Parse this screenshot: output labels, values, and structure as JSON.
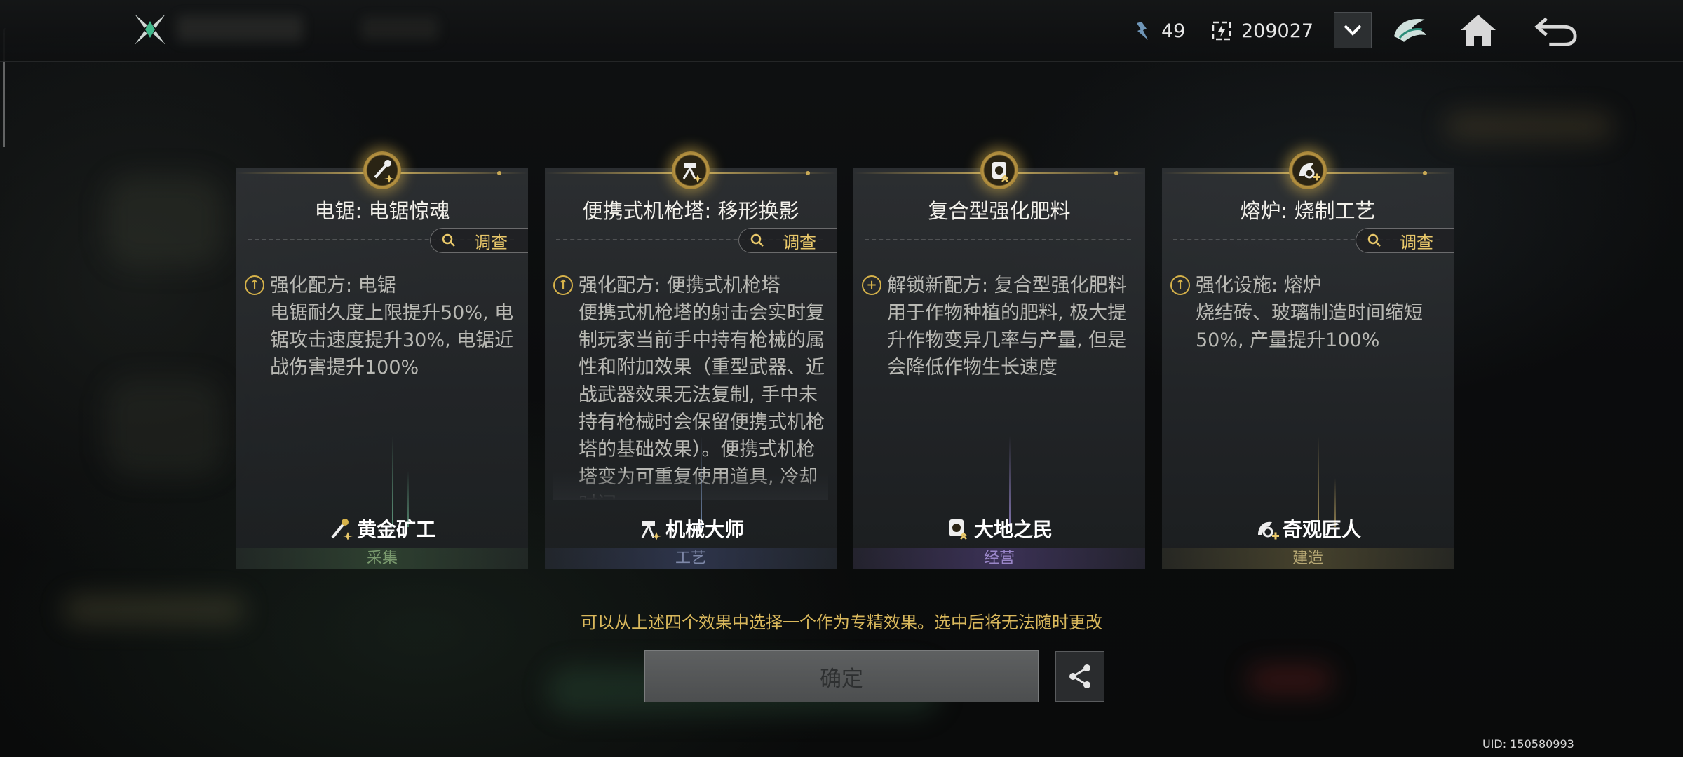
{
  "topbar": {
    "resource1_value": "49",
    "resource2_value": "209027"
  },
  "cards": [
    {
      "title": "电锯: 电锯惊魂",
      "investigate_label": "调查",
      "effect_head": "强化配方: 电锯",
      "effect_desc": "电锯耐久度上限提升50%, 电锯攻击速度提升30%, 电锯近战伤害提升100%",
      "role_name": "黄金矿工",
      "category": "采集",
      "category_color": "#7a9a6e"
    },
    {
      "title": "便携式机枪塔: 移形换影",
      "investigate_label": "调查",
      "effect_head": "强化配方: 便携式机枪塔",
      "effect_desc": "便携式机枪塔的射击会实时复制玩家当前手中持有枪械的属性和附加效果（重型武器、近战武器效果无法复制, 手中未持有枪械时会保留便携式机枪塔的基础效果）。便携式机枪塔变为可重复使用道具, 冷却时间",
      "role_name": "机械大师",
      "category": "工艺",
      "category_color": "#7e88a8"
    },
    {
      "title": "复合型强化肥料",
      "investigate_label": "",
      "effect_head": "解锁新配方: 复合型强化肥料",
      "effect_desc": "用于作物种植的肥料, 极大提升作物变异几率与产量, 但是会降低作物生长速度",
      "role_name": "大地之民",
      "category": "经营",
      "category_color": "#9a86c8"
    },
    {
      "title": "熔炉: 烧制工艺",
      "investigate_label": "调查",
      "effect_head": "强化设施: 熔炉",
      "effect_desc": "烧结砖、玻璃制造时间缩短50%, 产量提升100%",
      "role_name": "奇观匠人",
      "category": "建造",
      "category_color": "#b7a874"
    }
  ],
  "hint_text": "可以从上述四个效果中选择一个作为专精效果。选中后将无法随时更改",
  "confirm_label": "确定",
  "uid_text": "UID: 150580993",
  "icons": {
    "logo": "crossed-blades-logo-icon",
    "resource1": "energy-shard-icon",
    "resource2": "lightning-box-icon",
    "dropdown": "chevron-down-icon",
    "emblem": "winged-helmet-icon",
    "home": "home-icon",
    "back": "back-arrow-icon",
    "share": "share-icon"
  },
  "colors": {
    "accent_gold": "#e9c86a",
    "hint_gold": "#d9b85c"
  }
}
